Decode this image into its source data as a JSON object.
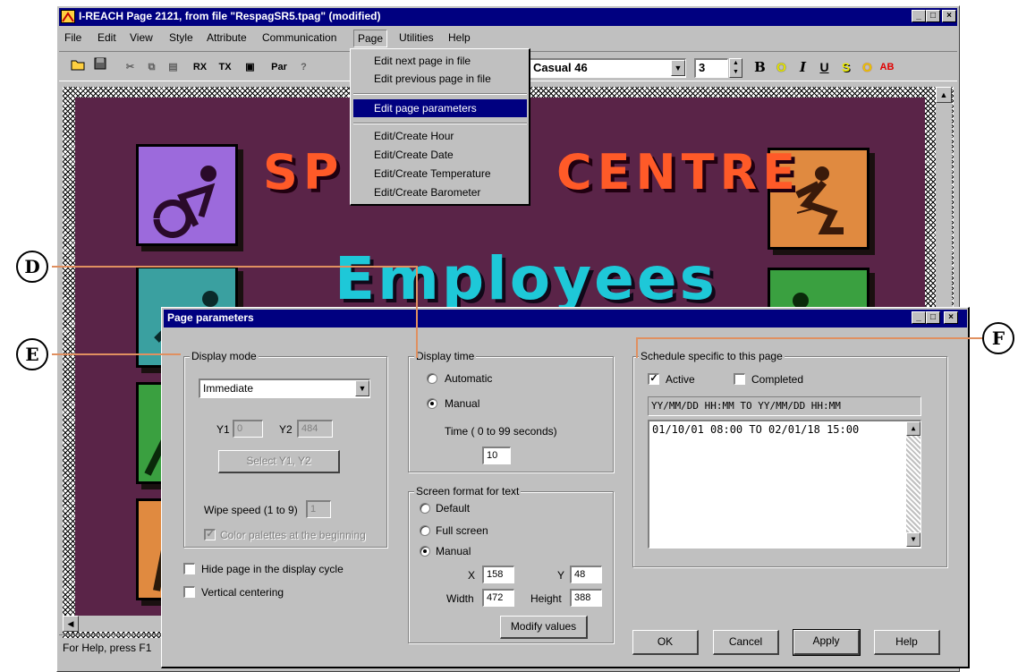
{
  "app": {
    "title": "I-REACH  Page 2121,  from file \"RespagSR5.tpag\" (modified)",
    "caption_buttons": [
      "_",
      "□",
      "×"
    ],
    "status_text": "For Help, press F1"
  },
  "menubar": [
    "File",
    "Edit",
    "View",
    "Style",
    "Attribute",
    "Communication",
    "Page",
    "Utilities",
    "Help"
  ],
  "toolbar": {
    "rx_label": "RX",
    "tx_label": "TX",
    "par_label": "Par",
    "font_name": "Casual 46",
    "font_size": "3",
    "style_buttons": [
      "B",
      "O",
      "I",
      "U",
      "S",
      "O",
      "AB"
    ]
  },
  "page_menu": {
    "items_group1": [
      "Edit next page in file",
      "Edit previous page in file"
    ],
    "selected_item": "Edit page parameters",
    "items_group2": [
      "Edit/Create Hour",
      "Edit/Create Date",
      "Edit/Create Temperature",
      "Edit/Create Barometer"
    ]
  },
  "canvas": {
    "banner_left": "SP",
    "banner_right": "CENTRE",
    "headline": "Employees",
    "colors": {
      "background": "#5a2448",
      "banner": "#ff5a28",
      "headline": "#1ec8d8"
    }
  },
  "dialog": {
    "title": "Page parameters",
    "display_mode": {
      "title": "Display mode",
      "selected": "Immediate",
      "y1_label": "Y1",
      "y1_value": "0",
      "y2_label": "Y2",
      "y2_value": "484",
      "select_button": "Select Y1, Y2",
      "wipe_label": "Wipe speed (1 to 9)",
      "wipe_value": "1",
      "color_palettes_label": "Color palettes at the beginning"
    },
    "hide_page_label": "Hide page in the display cycle",
    "vertical_centering_label": "Vertical centering",
    "display_time": {
      "title": "Display time",
      "automatic": "Automatic",
      "manual": "Manual",
      "time_label": "Time  ( 0 to  99 seconds)",
      "time_value": "10"
    },
    "screen_format": {
      "title": "Screen format for text",
      "default": "Default",
      "full_screen": "Full screen",
      "manual": "Manual",
      "x_label": "X",
      "x_value": "158",
      "y_label": "Y",
      "y_value": "48",
      "width_label": "Width",
      "width_value": "472",
      "height_label": "Height",
      "height_value": "388",
      "modify_button": "Modify values"
    },
    "schedule": {
      "title": "Schedule specific to this page",
      "active_label": "Active",
      "completed_label": "Completed",
      "header": "YY/MM/DD HH:MM TO YY/MM/DD HH:MM",
      "entries": [
        "01/10/01 08:00 TO 02/01/18 15:00"
      ]
    },
    "buttons": {
      "ok": "OK",
      "cancel": "Cancel",
      "apply": "Apply",
      "help": "Help"
    }
  },
  "callouts": [
    "D",
    "E",
    "F"
  ]
}
